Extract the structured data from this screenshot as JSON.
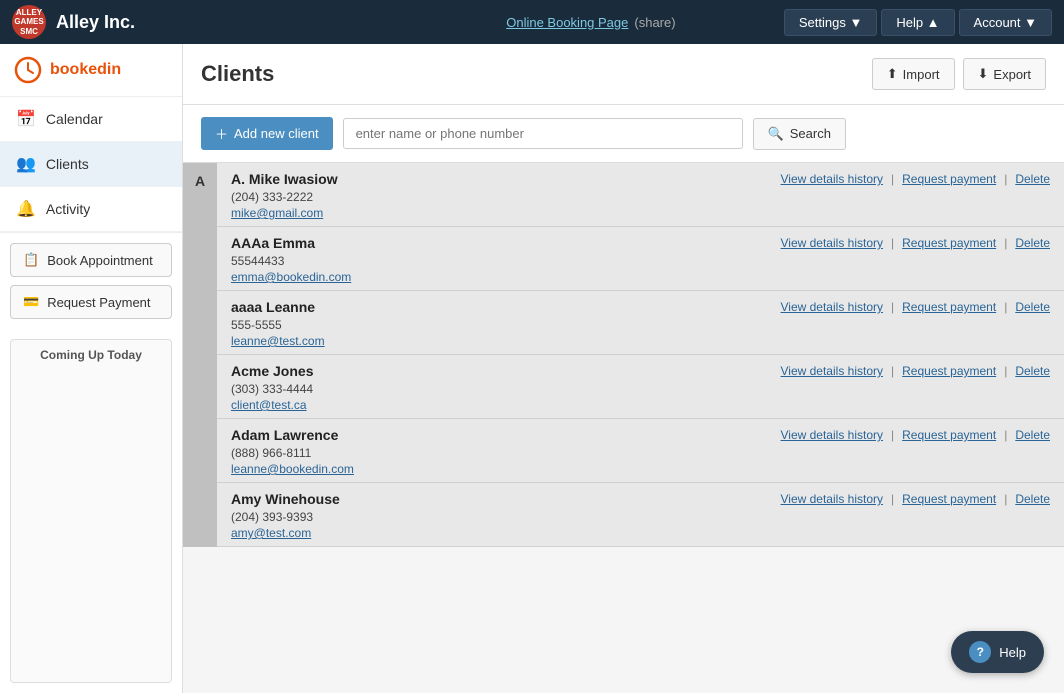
{
  "app": {
    "logo_text": "ALLEY\nGAMES\nSMC",
    "name": "Alley Inc.",
    "online_booking_label": "Online Booking Page",
    "share_label": "(share)",
    "settings_label": "Settings ▼",
    "help_label": "Help ▲",
    "account_label": "Account ▼"
  },
  "sidebar": {
    "brand_text": "bookedin",
    "nav_items": [
      {
        "id": "calendar",
        "icon": "📅",
        "label": "Calendar"
      },
      {
        "id": "clients",
        "icon": "👥",
        "label": "Clients"
      },
      {
        "id": "activity",
        "icon": "🔔",
        "label": "Activity"
      }
    ],
    "action_btns": [
      {
        "id": "book-appointment",
        "icon": "📋",
        "label": "Book Appointment"
      },
      {
        "id": "request-payment",
        "icon": "💳",
        "label": "Request Payment"
      }
    ],
    "coming_up_title": "Coming Up Today"
  },
  "header": {
    "page_title": "Clients",
    "import_label": "Import",
    "export_label": "Export"
  },
  "search_bar": {
    "add_client_label": "Add new client",
    "search_placeholder": "enter name or phone number",
    "search_label": "Search"
  },
  "clients": [
    {
      "section_letter": "A",
      "entries": [
        {
          "name": "A. Mike Iwasiow",
          "phone": "(204) 333-2222",
          "email": "mike@gmail.com",
          "view_label": "View details history",
          "request_label": "Request payment",
          "delete_label": "Delete"
        },
        {
          "name": "AAAa Emma",
          "phone": "55544433",
          "email": "emma@bookedin.com",
          "view_label": "View details history",
          "request_label": "Request payment",
          "delete_label": "Delete"
        },
        {
          "name": "aaaa Leanne",
          "phone": "555-5555",
          "email": "leanne@test.com",
          "view_label": "View details history",
          "request_label": "Request payment",
          "delete_label": "Delete"
        },
        {
          "name": "Acme Jones",
          "phone": "(303) 333-4444",
          "email": "client@test.ca",
          "view_label": "View details history",
          "request_label": "Request payment",
          "delete_label": "Delete"
        },
        {
          "name": "Adam Lawrence",
          "phone": "(888) 966-8111",
          "email": "leanne@bookedin.com",
          "view_label": "View details history",
          "request_label": "Request payment",
          "delete_label": "Delete"
        },
        {
          "name": "Amy Winehouse",
          "phone": "(204) 393-9393",
          "email": "amy@test.com",
          "view_label": "View details history",
          "request_label": "Request payment",
          "delete_label": "Delete"
        }
      ]
    }
  ],
  "help_float": {
    "label": "Help"
  }
}
